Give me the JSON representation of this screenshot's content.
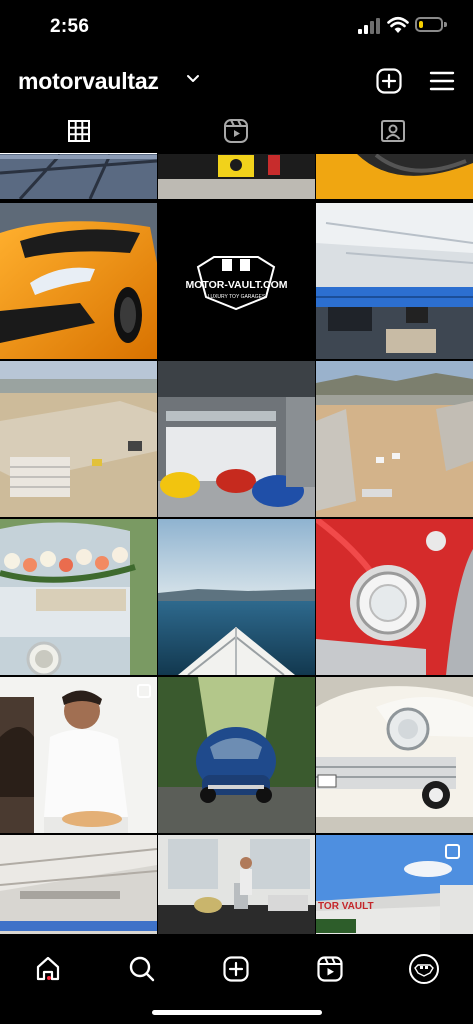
{
  "status_bar": {
    "time": "2:56",
    "battery_level": 0.22,
    "battery_color": "#f7d000"
  },
  "profile": {
    "username": "motorvaultaz"
  },
  "header_icons": [
    "chevron-down-icon",
    "new-post-plus-icon",
    "hamburger-menu-icon"
  ],
  "tabs": [
    {
      "icon": "grid-icon",
      "active": true
    },
    {
      "icon": "reels-icon",
      "active": false
    },
    {
      "icon": "tagged-user-icon",
      "active": false
    }
  ],
  "grid": {
    "columns": 3,
    "posts": [
      {
        "subject": "garage floor partial"
      },
      {
        "subject": "yellow banner partial"
      },
      {
        "subject": "yellow car hood partial"
      },
      {
        "subject": "orange Lamborghini"
      },
      {
        "subject": "Motor Vault logo",
        "logo_text": "MOTOR-VAULT.COM",
        "logo_subtext": "LUXURY TOY GARAGES"
      },
      {
        "subject": "interior mezzanine"
      },
      {
        "subject": "aerial construction site"
      },
      {
        "subject": "garage with Porsches"
      },
      {
        "subject": "construction site overview"
      },
      {
        "subject": "flower-decorated VW bus"
      },
      {
        "subject": "boat bow on water"
      },
      {
        "subject": "red classic car headlight"
      },
      {
        "subject": "chef at pizza oven",
        "multi": true
      },
      {
        "subject": "blue VW Beetle"
      },
      {
        "subject": "white Cadillac"
      },
      {
        "subject": "interior ceiling"
      },
      {
        "subject": "catering table"
      },
      {
        "subject": "Motor Vault building exterior",
        "multi": true,
        "sign_text": "TOR VAULT"
      }
    ]
  },
  "bottom_nav": [
    {
      "icon": "home-icon",
      "active": true,
      "notification_dot": true
    },
    {
      "icon": "search-icon"
    },
    {
      "icon": "create-post-icon"
    },
    {
      "icon": "reels-icon"
    },
    {
      "icon": "profile-avatar-icon"
    }
  ]
}
